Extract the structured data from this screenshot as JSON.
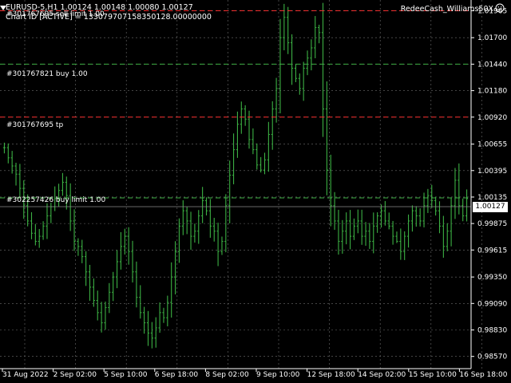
{
  "header": {
    "symbol_line": "EURUSD-5,H1  1.00124 1.00148 1.00080 1.00127",
    "chart_id_line": "Chart ID [ACTIVE] = 133079707158350128.00000000",
    "account": "RedeeCash_Williams50X"
  },
  "orders": [
    {
      "label": "#301767695 sell limit 1.00",
      "color": "#ff3030"
    },
    {
      "label": "#301767821 buy 1.00",
      "color": "#3cb043"
    },
    {
      "label": "#301767695 tp",
      "color": "#ff3030"
    },
    {
      "label": "#302257426 buy limit 1.00",
      "color": "#3cb043"
    }
  ],
  "current_price": "1.00127",
  "chart_data": {
    "type": "bar",
    "symbol": "EURUSD",
    "timeframe": "H1",
    "y_ticks": [
      "1.01965",
      "1.01700",
      "1.01440",
      "1.01180",
      "1.00920",
      "1.00655",
      "1.00395",
      "1.00135",
      "0.99875",
      "0.99615",
      "0.99350",
      "0.99090",
      "0.98830",
      "0.98570"
    ],
    "x_ticks": [
      "31 Aug 2022",
      "2 Sep 02:00",
      "5 Sep 10:00",
      "6 Sep 18:00",
      "8 Sep 02:00",
      "9 Sep 10:00",
      "12 Sep 18:00",
      "14 Sep 02:00",
      "15 Sep 10:00",
      "16 Sep 18:00"
    ],
    "ylim": [
      0.9845,
      1.0207
    ],
    "order_levels": [
      1.01965,
      1.0144,
      1.0092,
      1.00127
    ],
    "grid": true,
    "closes": [
      1.0062,
      1.0052,
      1.0044,
      1.0036,
      1.0022,
      1.0005,
      0.999,
      0.9978,
      0.997,
      0.9975,
      0.9985,
      0.9995,
      1.0004,
      1.0012,
      1.002,
      1.0028,
      1.0015,
      0.999,
      0.997,
      0.9965,
      0.9955,
      0.994,
      0.9925,
      0.9912,
      0.99,
      0.989,
      0.9905,
      0.992,
      0.9935,
      0.995,
      0.9965,
      0.9975,
      0.996,
      0.994,
      0.9915,
      0.99,
      0.989,
      0.988,
      0.9875,
      0.9885,
      0.99,
      0.9895,
      0.991,
      0.9935,
      0.996,
      0.9985,
      1.0,
      0.999,
      0.9975,
      0.998,
      0.9995,
      1.001,
      1.0,
      0.9985,
      0.998,
      0.996,
      0.997,
      1.0005,
      1.0035,
      1.006,
      1.0085,
      1.01,
      1.009,
      1.007,
      1.006,
      1.0045,
      1.004,
      1.005,
      1.0075,
      1.01,
      1.012,
      1.017,
      1.019,
      1.0165,
      1.014,
      1.013,
      1.012,
      1.014,
      1.015,
      1.016,
      1.018,
      1.0175,
      1.01,
      1.004,
      1.0005,
      0.999,
      0.997,
      0.998,
      0.999,
      0.9975,
      0.9985,
      0.999,
      0.9975,
      0.998,
      0.997,
      0.9985,
      0.9995,
      1.0,
      0.999,
      0.9985,
      0.9975,
      0.997,
      0.996,
      0.9975,
      0.999,
      1.0,
      0.9995,
      0.999,
      1.0005,
      1.0015,
      1.001,
      1.0,
      0.9985,
      0.9965,
      0.998,
      1.0005,
      1.003,
      1.0005,
      0.9995,
      1.0012
    ]
  }
}
